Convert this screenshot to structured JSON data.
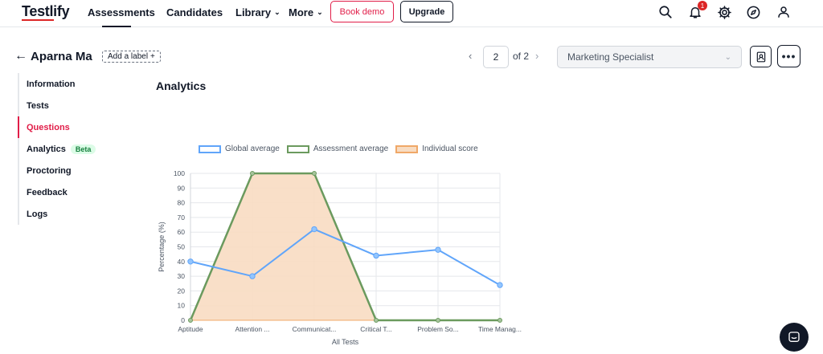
{
  "header": {
    "logo": "Testlify",
    "nav": [
      {
        "label": "Assessments",
        "active": true
      },
      {
        "label": "Candidates"
      },
      {
        "label": "Library",
        "dropdown": true
      },
      {
        "label": "More",
        "dropdown": true
      }
    ],
    "book_demo_label": "Book demo",
    "upgrade_label": "Upgrade",
    "notification_count": "1",
    "icons": [
      "search-icon",
      "bell-icon",
      "gear-icon",
      "compass-icon",
      "user-icon"
    ]
  },
  "candidate": {
    "name": "Aparna Ma",
    "add_label": "Add a label",
    "pager_current": "2",
    "pager_total": "of 2",
    "job_role": "Marketing Specialist"
  },
  "sidebar": {
    "items": [
      {
        "label": "Information"
      },
      {
        "label": "Tests"
      },
      {
        "label": "Questions",
        "active": true
      },
      {
        "label": "Analytics",
        "badge": "Beta"
      },
      {
        "label": "Proctoring"
      },
      {
        "label": "Feedback"
      },
      {
        "label": "Logs"
      }
    ]
  },
  "main": {
    "title": "Analytics"
  },
  "colors": {
    "accent": "#e11d48",
    "global": "#60a5fa",
    "assessment": "#6b9a5e",
    "individual_fill": "#f8dcc2",
    "individual_stroke": "#f0a868"
  },
  "chart_data": {
    "type": "line",
    "categories": [
      "Aptitude",
      "Attention ...",
      "Communicat...",
      "Critical T...",
      "Problem So...",
      "Time Manag..."
    ],
    "series": [
      {
        "name": "Global average",
        "values": [
          40,
          30,
          62,
          44,
          48,
          24
        ]
      },
      {
        "name": "Assessment average",
        "values": [
          0,
          100,
          100,
          0,
          0,
          0
        ]
      },
      {
        "name": "Individual score",
        "values": [
          0,
          100,
          100,
          0,
          0,
          0
        ],
        "style": "area"
      }
    ],
    "xlabel": "All Tests",
    "ylabel": "Percentage (%)",
    "ylim": [
      0,
      100
    ],
    "yticks": [
      0,
      10,
      20,
      30,
      40,
      50,
      60,
      70,
      80,
      90,
      100
    ],
    "grid": true,
    "legend": "top"
  }
}
